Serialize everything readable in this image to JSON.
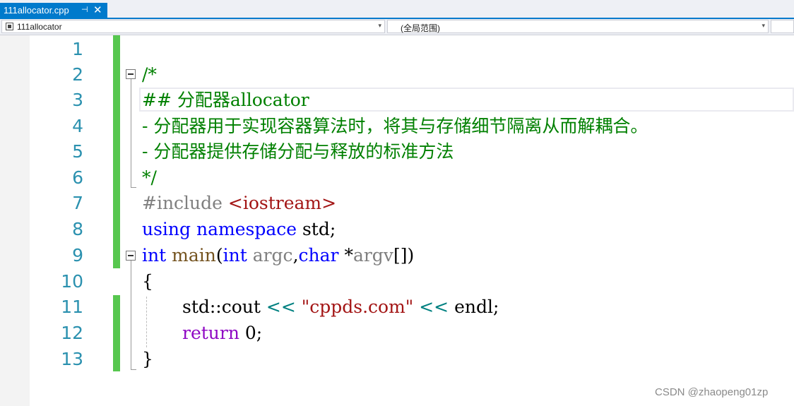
{
  "tab": {
    "title": "111allocator.cpp",
    "pin_glyph": "⊣",
    "close_glyph": "✕"
  },
  "navbar": {
    "project": "111allocator",
    "scope": "(全局范围)",
    "dropdown_glyph": "▾"
  },
  "editor": {
    "line_numbers": [
      "1",
      "2",
      "3",
      "4",
      "5",
      "6",
      "7",
      "8",
      "9",
      "10",
      "11",
      "12",
      "13"
    ],
    "line_2": "/*",
    "line_3": "## 分配器allocator",
    "line_4": "- 分配器用于实现容器算法时，将其与存储细节隔离从而解耦合。",
    "line_5": "- 分配器提供存储分配与释放的标准方法",
    "line_6": "*/",
    "line_7": {
      "directive": "#include ",
      "header": "<iostream>"
    },
    "line_8": {
      "kw1": "using",
      "kw2": "namespace",
      "rest": " std;"
    },
    "line_9": {
      "kw_int": "int",
      "fn": "main",
      "open": "(",
      "kw_int2": "int",
      "p1": "argc",
      "comma": ",",
      "kw_char": "char",
      "star": " *",
      "p2": "argv",
      "close": "[])"
    },
    "line_10": "{",
    "line_11": {
      "obj": "std::cout ",
      "op1": "<<",
      "str": "\"cppds.com\"",
      "op2": "<<",
      "end": " endl;"
    },
    "line_12": {
      "kw": "return",
      "rest": " 0;"
    },
    "line_13": "}"
  },
  "watermark": "CSDN @zhaopeng01zp",
  "colors": {
    "accent": "#007acc",
    "line_number": "#2b91af",
    "comment": "#008000",
    "keyword": "#0000ff",
    "control_keyword": "#8f08c4",
    "string": "#a31515",
    "change_bar": "#57c74f"
  }
}
